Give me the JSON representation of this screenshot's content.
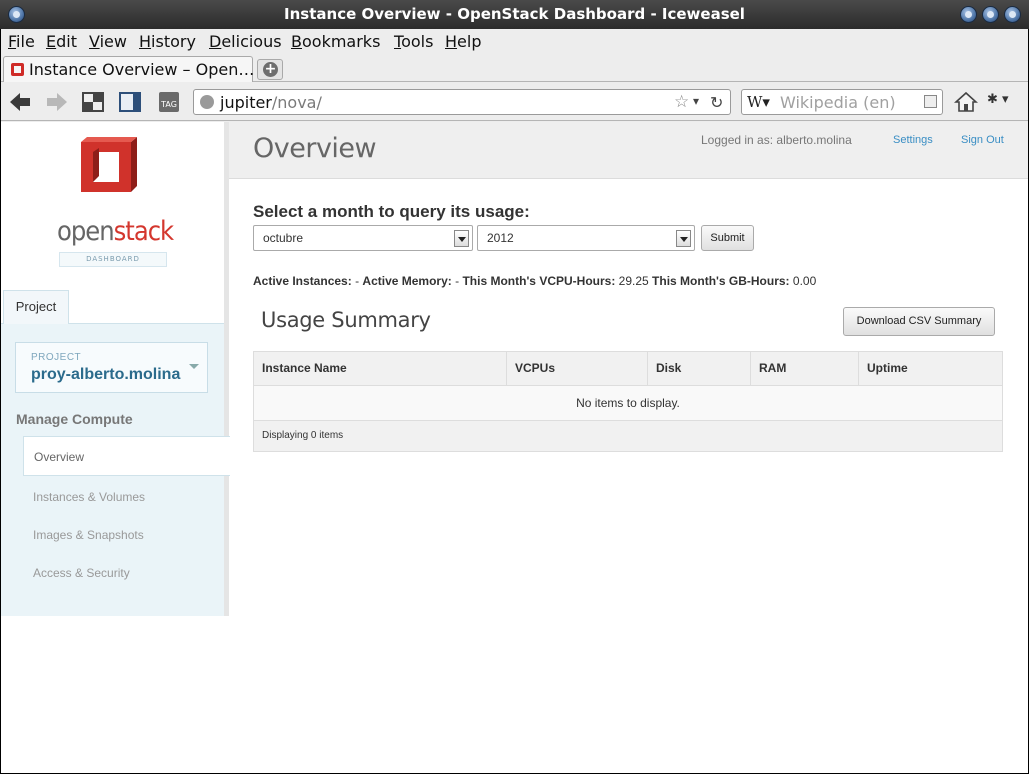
{
  "window": {
    "title": "Instance Overview - OpenStack Dashboard - Iceweasel"
  },
  "menubar": {
    "items": [
      {
        "label": "File",
        "key": "F",
        "rest": "ile"
      },
      {
        "label": "Edit",
        "key": "E",
        "rest": "dit"
      },
      {
        "label": "View",
        "key": "V",
        "rest": "iew"
      },
      {
        "label": "History",
        "key": "H",
        "rest": "istory"
      },
      {
        "label": "Delicious",
        "key": "D",
        "rest": "elicious"
      },
      {
        "label": "Bookmarks",
        "key": "B",
        "rest": "ookmarks"
      },
      {
        "label": "Tools",
        "key": "T",
        "rest": "ools"
      },
      {
        "label": "Help",
        "key": "H",
        "rest": "elp"
      }
    ]
  },
  "tab": {
    "label": "Instance Overview – Open…"
  },
  "navbar": {
    "url_host": "jupiter",
    "url_path": "/nova/",
    "search_engine": "W",
    "search_placeholder": "Wikipedia (en)",
    "tag_label": "TAG"
  },
  "logo": {
    "word_open": "open",
    "word_stack": "stack",
    "dashboard": "DASHBOARD"
  },
  "sidebar": {
    "tab": "Project",
    "project_label": "PROJECT",
    "project_name": "proy-alberto.molina",
    "section": "Manage Compute",
    "items": [
      {
        "label": "Overview",
        "active": true
      },
      {
        "label": "Instances & Volumes",
        "active": false
      },
      {
        "label": "Images & Snapshots",
        "active": false
      },
      {
        "label": "Access & Security",
        "active": false
      }
    ]
  },
  "header": {
    "title": "Overview",
    "logged_in": "Logged in as: alberto.molina",
    "settings": "Settings",
    "sign_out": "Sign Out"
  },
  "query": {
    "title": "Select a month to query its usage:",
    "month": "octubre",
    "year": "2012",
    "submit": "Submit"
  },
  "stats": {
    "active_instances_label": "Active Instances:",
    "active_instances_value": "-",
    "active_memory_label": "Active Memory:",
    "active_memory_value": "-",
    "vcpu_label": "This Month's VCPU-Hours:",
    "vcpu_value": "29.25",
    "gb_label": "This Month's GB-Hours:",
    "gb_value": "0.00"
  },
  "usage": {
    "title": "Usage Summary",
    "download": "Download CSV Summary",
    "columns": [
      "Instance Name",
      "VCPUs",
      "Disk",
      "RAM",
      "Uptime"
    ],
    "empty": "No items to display.",
    "footer": "Displaying 0 items"
  }
}
